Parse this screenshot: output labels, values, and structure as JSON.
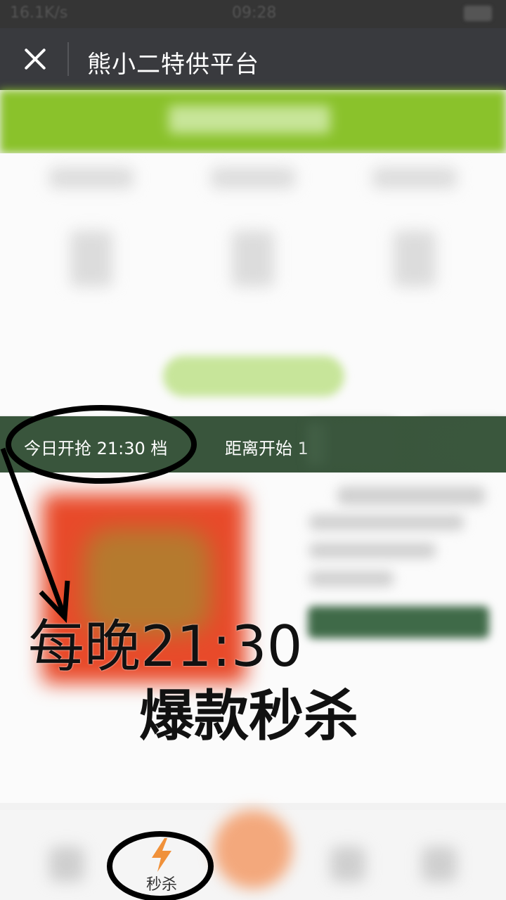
{
  "status_bar": {
    "speed": "16.1K/s",
    "time": "09:28"
  },
  "nav": {
    "title": "熊小二特供平台"
  },
  "countdown_bar": {
    "left_text": "今日开抢 21:30 档",
    "right_text": "距离开始 1"
  },
  "annotation": {
    "line1": "每晚21:30",
    "line2": "爆款秒杀"
  },
  "bottom_tab": {
    "seckill_label": "秒杀",
    "seckill_icon": "lightning-icon"
  },
  "colors": {
    "nav": "#393a3e",
    "green": "#8ac22b",
    "dark_green": "#39553c",
    "accent": "#f0913a"
  }
}
